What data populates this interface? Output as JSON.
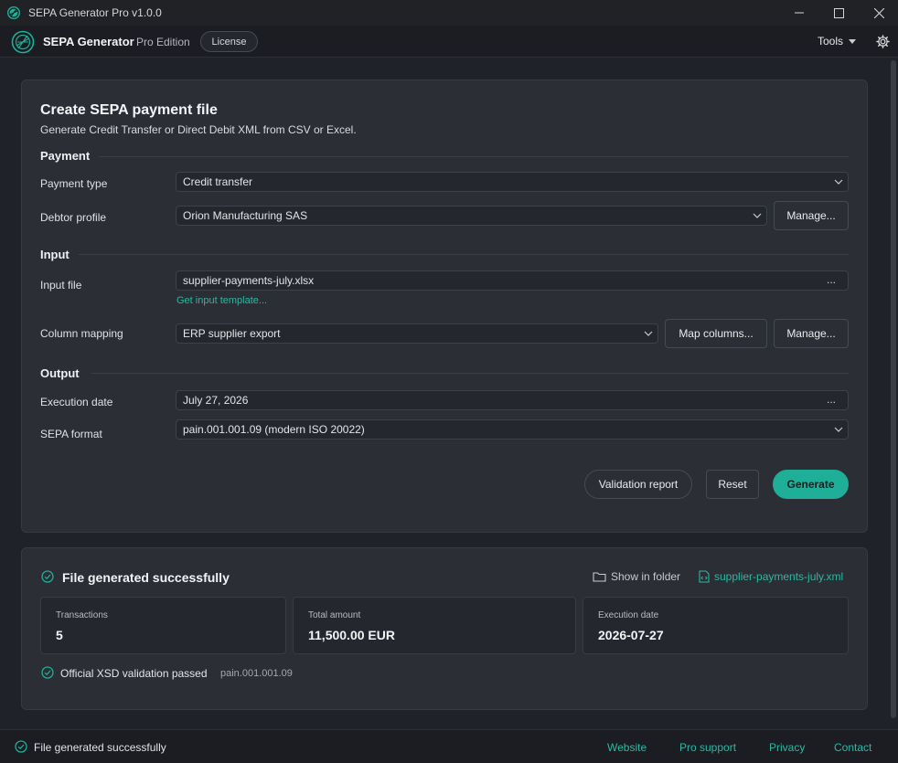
{
  "window": {
    "title": "SEPA Generator Pro v1.0.0"
  },
  "header": {
    "brand": "SEPA Generator",
    "edition": "Pro Edition",
    "license_label": "License",
    "tools_label": "Tools"
  },
  "form": {
    "title": "Create SEPA payment file",
    "subtitle": "Generate Credit Transfer or Direct Debit XML from CSV or Excel.",
    "sections": {
      "payment": "Payment",
      "input": "Input",
      "output": "Output"
    },
    "payment_type": {
      "label": "Payment type",
      "value": "Credit transfer"
    },
    "debtor_profile": {
      "label": "Debtor profile",
      "value": "Orion Manufacturing SAS",
      "manage_label": "Manage..."
    },
    "input_file": {
      "label": "Input file",
      "value": "supplier-payments-july.xlsx",
      "browse_label": "...",
      "template_link": "Get input template..."
    },
    "column_mapping": {
      "label": "Column mapping",
      "value": "ERP supplier export",
      "map_label": "Map columns...",
      "manage_label": "Manage..."
    },
    "execution_date": {
      "label": "Execution date",
      "value": "July 27, 2026",
      "picker_label": "..."
    },
    "sepa_format": {
      "label": "SEPA format",
      "value": "pain.001.001.09 (modern ISO 20022)"
    },
    "actions": {
      "validation_report": "Validation report",
      "reset": "Reset",
      "generate": "Generate"
    }
  },
  "result": {
    "title": "File generated successfully",
    "show_in_folder": "Show in folder",
    "file_name": "supplier-payments-july.xml",
    "stats": [
      {
        "label": "Transactions",
        "value": "5"
      },
      {
        "label": "Total amount",
        "value": "11,500.00 EUR"
      },
      {
        "label": "Execution date",
        "value": "2026-07-27"
      }
    ],
    "validation_text": "Official XSD validation passed",
    "validation_format": "pain.001.001.09"
  },
  "statusbar": {
    "message": "File generated successfully",
    "links": [
      "Website",
      "Pro support",
      "Privacy",
      "Contact"
    ]
  },
  "colors": {
    "accent": "#1fae98",
    "link": "#2bb8a3",
    "background": "#1f2229",
    "card": "#2b2e35"
  }
}
